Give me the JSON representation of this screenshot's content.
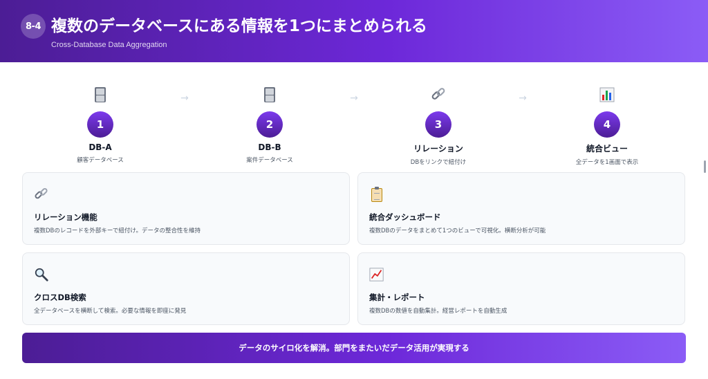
{
  "header": {
    "badge": "8-4",
    "title": "複数のデータベースにある情報を1つにまとめられる",
    "subtitle": "Cross-Database Data Aggregation"
  },
  "steps": [
    {
      "icon": "file-cabinet-icon",
      "number": "1",
      "name": "DB-A",
      "desc": "顧客データベース"
    },
    {
      "icon": "file-cabinet-icon",
      "number": "2",
      "name": "DB-B",
      "desc": "案件データベース"
    },
    {
      "icon": "link-icon",
      "number": "3",
      "name": "リレーション",
      "desc": "DBをリンクで紐付け"
    },
    {
      "icon": "bar-chart-icon",
      "number": "4",
      "name": "統合ビュー",
      "desc": "全データを1画面で表示"
    }
  ],
  "arrow": "→",
  "cards": [
    {
      "icon": "link-icon",
      "title": "リレーション機能",
      "desc": "複数DBのレコードを外部キーで紐付け。データの整合性を維持"
    },
    {
      "icon": "clipboard-icon",
      "title": "統合ダッシュボード",
      "desc": "複数DBのデータをまとめて1つのビューで可視化。横断分析が可能"
    },
    {
      "icon": "magnifier-icon",
      "title": "クロスDB検索",
      "desc": "全データベースを横断して検索。必要な情報を即座に発見"
    },
    {
      "icon": "line-chart-icon",
      "title": "集計・レポート",
      "desc": "複数DBの数値を自動集計。経営レポートを自動生成"
    }
  ],
  "banner": "データのサイロ化を解消。部門をまたいだデータ活用が実現する"
}
